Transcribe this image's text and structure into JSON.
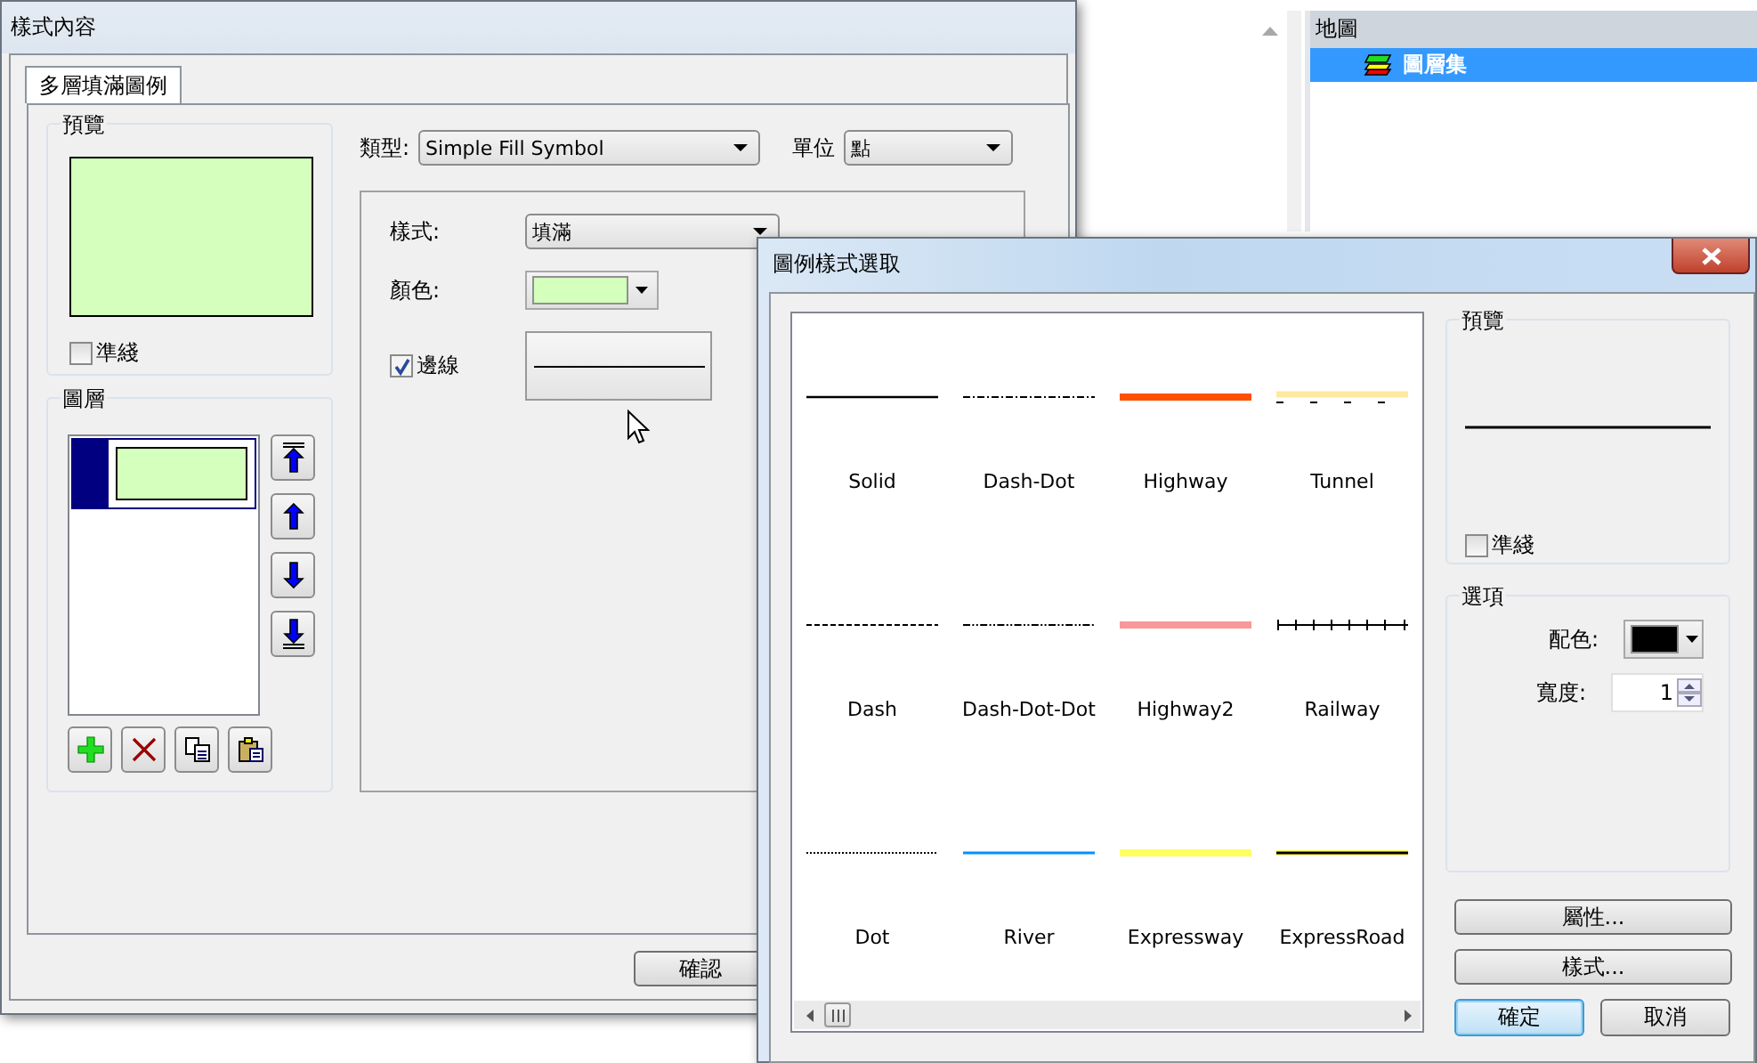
{
  "map_tree": {
    "header": "地圖",
    "items": [
      {
        "label": "圖層集",
        "selected": true
      }
    ]
  },
  "main_window": {
    "title": "樣式內容",
    "tabs": [
      {
        "label": "多層填滿圖例",
        "selected": true
      }
    ],
    "preview": {
      "title": "預覽",
      "guide": {
        "label": "準綫",
        "checked": false
      }
    },
    "layers": {
      "title": "圖層",
      "items": [
        {
          "selected": true
        }
      ]
    },
    "type": {
      "label": "類型:",
      "value": "Simple Fill Symbol"
    },
    "unit": {
      "label": "單位",
      "value": "點"
    },
    "style": {
      "label": "樣式:",
      "value": "填滿"
    },
    "color": {
      "label": "顏色:"
    },
    "outline": {
      "label": "邊線",
      "checked": true
    },
    "ok_button": "確認"
  },
  "dialog": {
    "title": "圖例樣式選取",
    "symbols": [
      {
        "label": "Solid",
        "kind": "solid",
        "color": "#000000"
      },
      {
        "label": "Dash-Dot",
        "kind": "dashdot",
        "color": "#000000"
      },
      {
        "label": "Highway",
        "kind": "thick",
        "color": "#ff5000"
      },
      {
        "label": "Tunnel",
        "kind": "tunnel",
        "color": "#ffe8a0"
      },
      {
        "label": "Dash",
        "kind": "dash",
        "color": "#000000"
      },
      {
        "label": "Dash-Dot-Dot",
        "kind": "dashdotdot",
        "color": "#000000"
      },
      {
        "label": "Highway2",
        "kind": "thick",
        "color": "#f89898"
      },
      {
        "label": "Railway",
        "kind": "railway",
        "color": "#000000"
      },
      {
        "label": "Dot",
        "kind": "dot",
        "color": "#000000"
      },
      {
        "label": "River",
        "kind": "thin",
        "color": "#0090ff"
      },
      {
        "label": "Expressway",
        "kind": "thick",
        "color": "#ffff60"
      },
      {
        "label": "ExpressRoad",
        "kind": "road",
        "color": "#ffff60"
      }
    ],
    "preview": {
      "title": "預覽",
      "guide": {
        "label": "準綫",
        "checked": false
      }
    },
    "options": {
      "title": "選項",
      "color": {
        "label": "配色:"
      },
      "width": {
        "label": "寬度:",
        "value": "1"
      }
    },
    "buttons": [
      {
        "label": "屬性...",
        "kind": "wide",
        "default": false
      },
      {
        "label": "樣式...",
        "kind": "wide",
        "default": false
      },
      {
        "label": "確定",
        "kind": "half",
        "default": true
      },
      {
        "label": "取消",
        "kind": "half",
        "default": false
      }
    ]
  }
}
